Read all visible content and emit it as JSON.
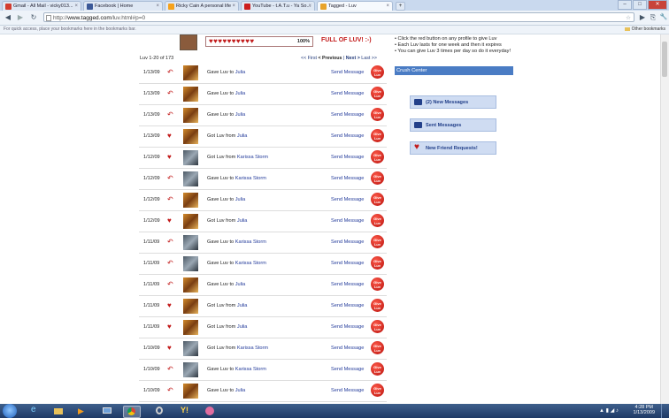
{
  "tabs": [
    {
      "title": "Gmail - All Mail - vicky013...",
      "favicon_color": "#d33c2f"
    },
    {
      "title": "Facebook | Home",
      "favicon_color": "#3b5998"
    },
    {
      "title": "Ricky Cain A personal life",
      "favicon_color": "#f6a21b"
    },
    {
      "title": "YouTube - t.A.T.u - Ya So...",
      "favicon_color": "#cc1e1e"
    },
    {
      "title": "Tagged - Luv",
      "favicon_color": "#e8a32a"
    }
  ],
  "window_controls": {
    "minimize": "–",
    "maximize": "□",
    "close": "✕"
  },
  "address": {
    "prefix": "http://",
    "host": "www.tagged.com",
    "path": "/luv.html#p=0"
  },
  "nav_glyphs": {
    "back": "◀",
    "forward": "▶",
    "reload": "↻",
    "star": "☆",
    "go": "▶",
    "page": "⎘",
    "tools": "🔧"
  },
  "bookmarks_bar": {
    "message": "For quick access, place your bookmarks here in the bookmarks bar.",
    "other": "Other bookmarks"
  },
  "header": {
    "hearts": "♥♥♥♥♥♥♥♥♥♥",
    "percent": "100%",
    "full_label": "FULL OF LUV! :-)"
  },
  "tips": [
    "Click the red button on any profile to give Luv",
    "Each Luv lasts for one week and then it expires",
    "You can give Luv 3 times per day so do it everyday!"
  ],
  "luv_count": "Luv 1-20 of 173",
  "pager": {
    "first": "<< First",
    "prev": "< Previous",
    "sep": "|",
    "next": "Next >",
    "last": "Last >>"
  },
  "row_labels": {
    "send": "Send Message",
    "give_line1": "Give",
    "give_line2": "Luv"
  },
  "rows": [
    {
      "date": "1/13/09",
      "kind": "gave",
      "action": "Gave Luv to",
      "who": "Julia"
    },
    {
      "date": "1/13/09",
      "kind": "gave",
      "action": "Gave Luv to",
      "who": "Julia"
    },
    {
      "date": "1/13/09",
      "kind": "gave",
      "action": "Gave Luv to",
      "who": "Julia"
    },
    {
      "date": "1/13/09",
      "kind": "got",
      "action": "Got Luv from",
      "who": "Julia"
    },
    {
      "date": "1/12/09",
      "kind": "got",
      "action": "Got Luv from",
      "who": "Karissa Storm"
    },
    {
      "date": "1/12/09",
      "kind": "gave",
      "action": "Gave Luv to",
      "who": "Karissa Storm"
    },
    {
      "date": "1/12/09",
      "kind": "gave",
      "action": "Gave Luv to",
      "who": "Julia"
    },
    {
      "date": "1/12/09",
      "kind": "got",
      "action": "Got Luv from",
      "who": "Julia"
    },
    {
      "date": "1/11/09",
      "kind": "gave",
      "action": "Gave Luv to",
      "who": "Karissa Storm"
    },
    {
      "date": "1/11/09",
      "kind": "gave",
      "action": "Gave Luv to",
      "who": "Karissa Storm"
    },
    {
      "date": "1/11/09",
      "kind": "gave",
      "action": "Gave Luv to",
      "who": "Julia"
    },
    {
      "date": "1/11/09",
      "kind": "got",
      "action": "Got Luv from",
      "who": "Julia"
    },
    {
      "date": "1/11/09",
      "kind": "got",
      "action": "Got Luv from",
      "who": "Julia"
    },
    {
      "date": "1/10/09",
      "kind": "got",
      "action": "Got Luv from",
      "who": "Karissa Storm"
    },
    {
      "date": "1/10/09",
      "kind": "gave",
      "action": "Gave Luv to",
      "who": "Karissa Storm"
    },
    {
      "date": "1/10/09",
      "kind": "gave",
      "action": "Gave Luv to",
      "who": "Julia"
    },
    {
      "date": "1/10/09",
      "kind": "gave",
      "action": "Gave Luv to",
      "who": "Julia"
    }
  ],
  "sidebar": {
    "crush_center": "Crush Center",
    "new_messages": "(2) New Messages",
    "sent_messages": "Sent Messages",
    "friend_requests": "New Friend Requests!"
  },
  "colors": {
    "accent_blue": "#4a7cc4",
    "heart_red": "#c21a1a",
    "link_blue": "#223a9a"
  },
  "taskbar": {
    "time": "4:28 PM",
    "date": "1/13/2009"
  }
}
